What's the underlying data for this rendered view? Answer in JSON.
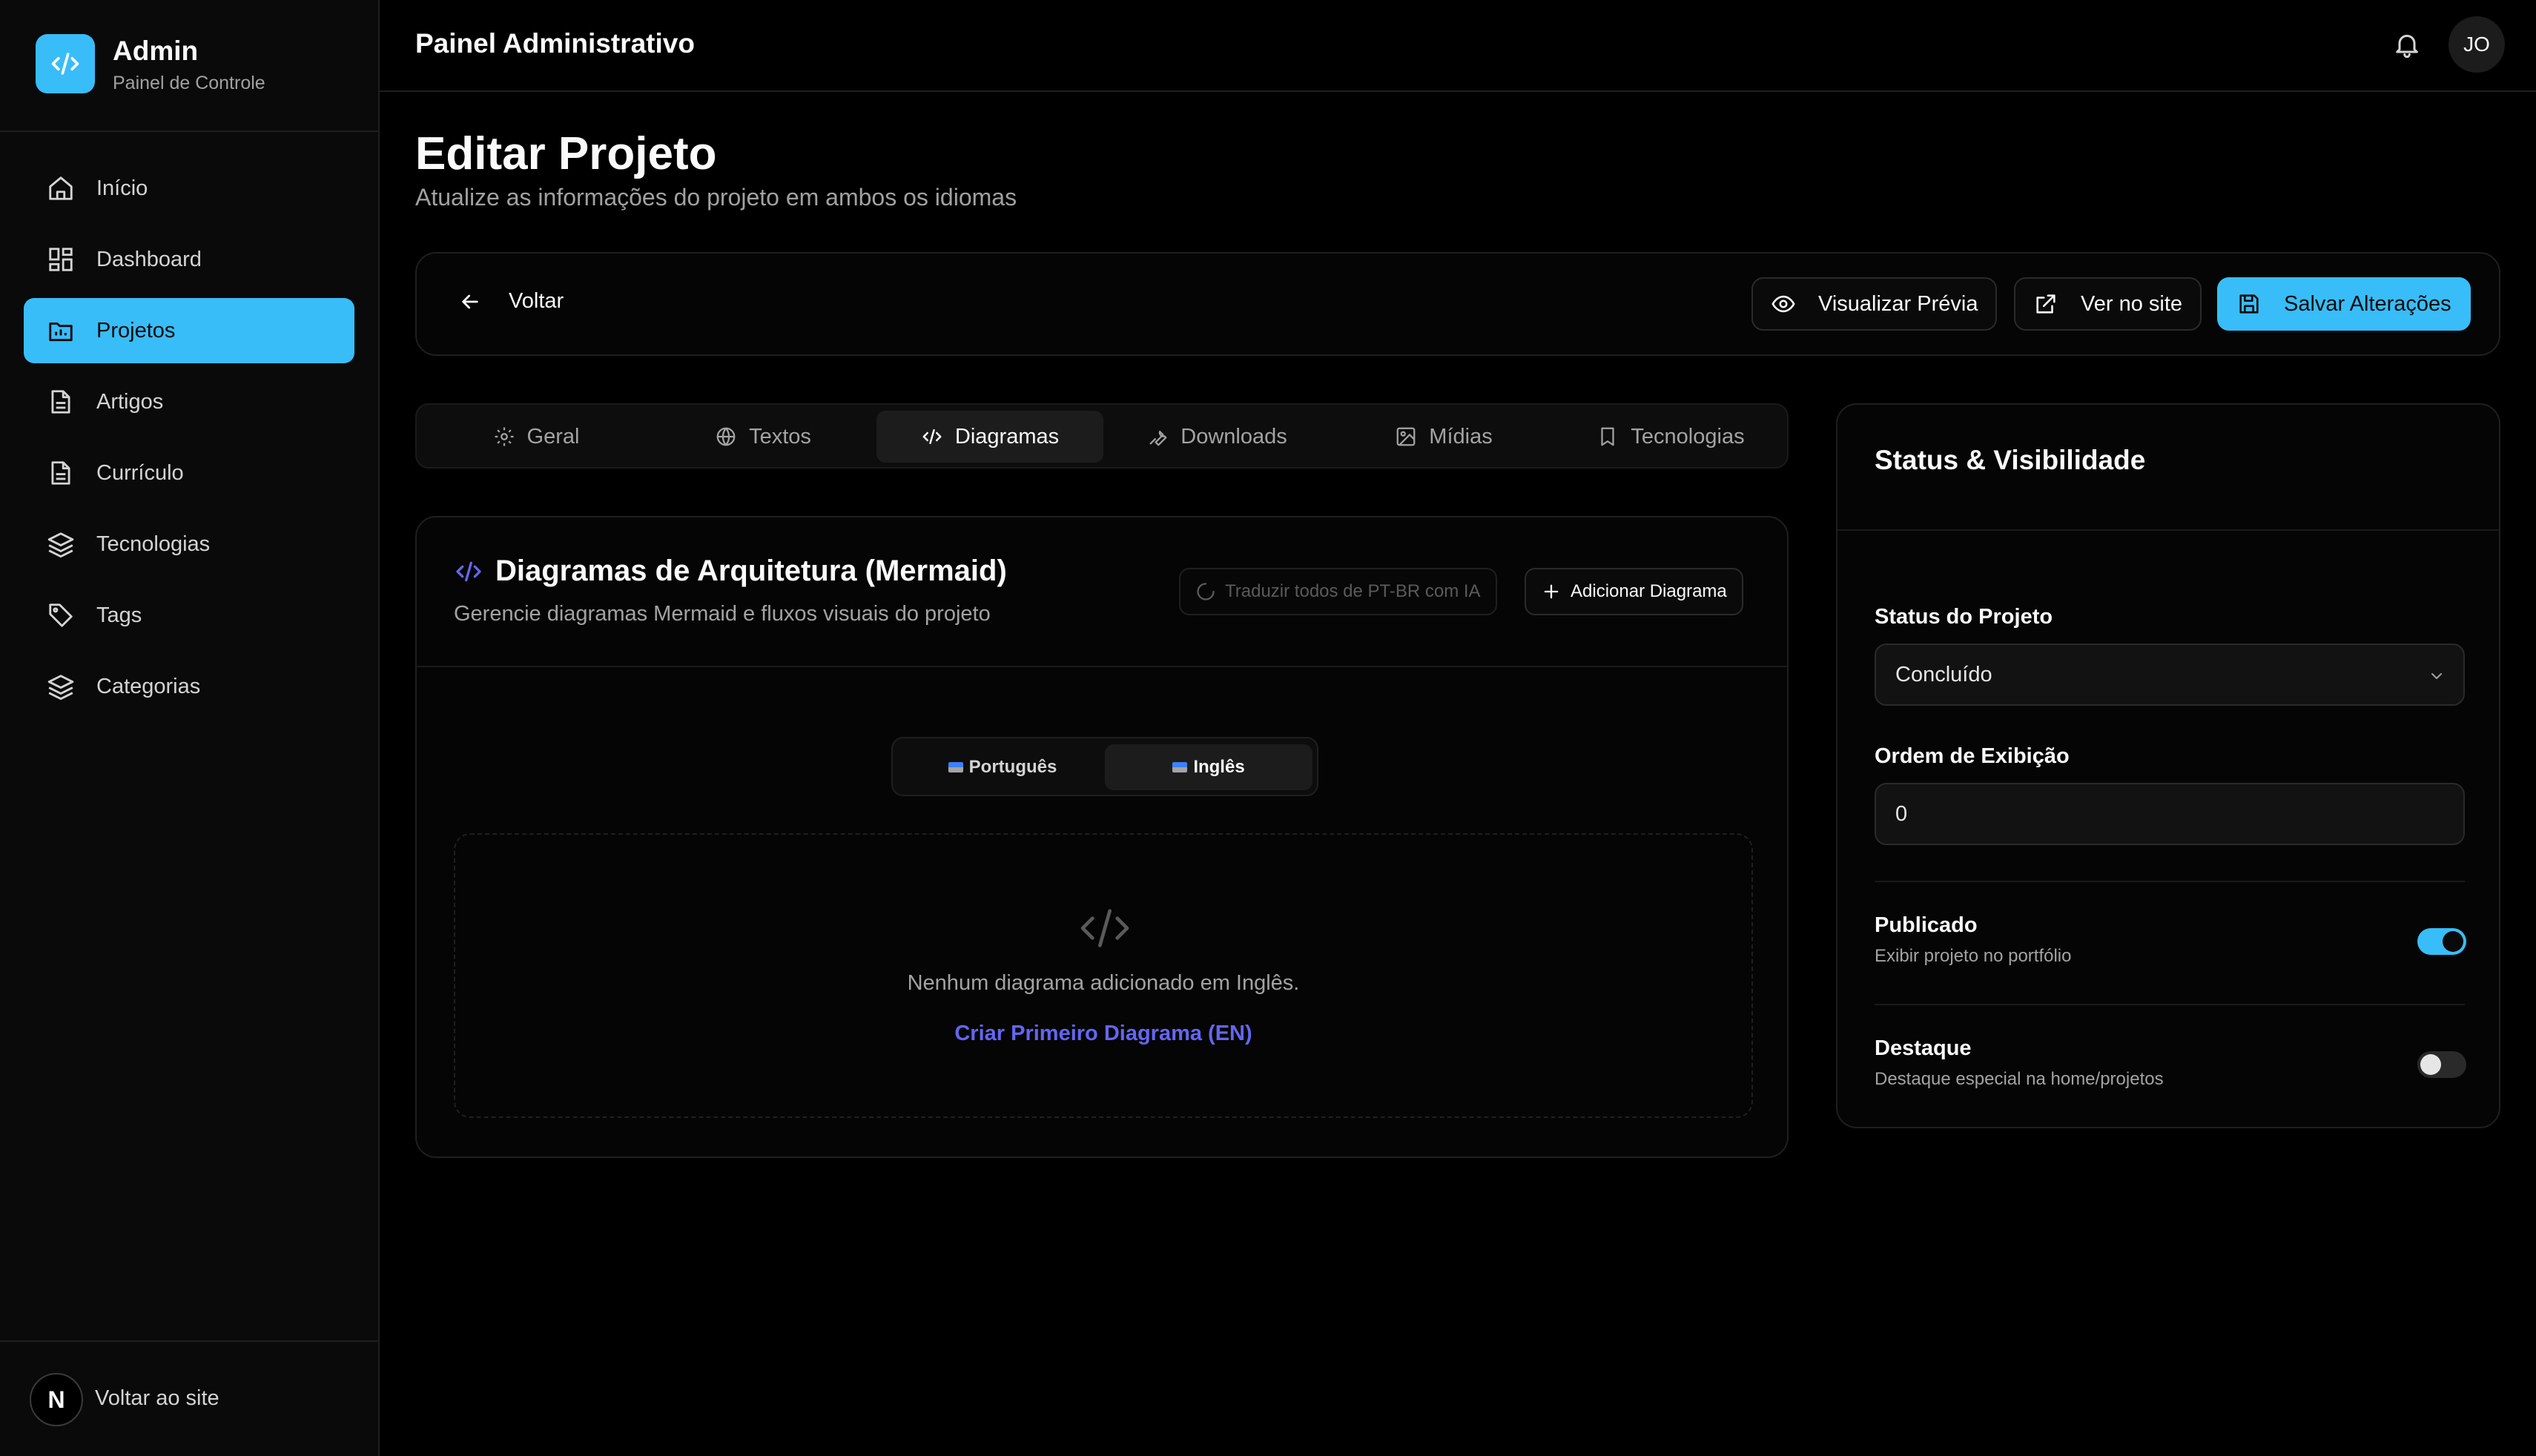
{
  "brand": {
    "title": "Admin",
    "subtitle": "Painel de Controle"
  },
  "sidebar": {
    "items": [
      {
        "label": "Início",
        "icon": "home-icon"
      },
      {
        "label": "Dashboard",
        "icon": "dashboard-icon"
      },
      {
        "label": "Projetos",
        "icon": "folder-icon",
        "active": true
      },
      {
        "label": "Artigos",
        "icon": "file-icon"
      },
      {
        "label": "Currículo",
        "icon": "file-icon"
      },
      {
        "label": "Tecnologias",
        "icon": "layers-icon"
      },
      {
        "label": "Tags",
        "icon": "tag-icon"
      },
      {
        "label": "Categorias",
        "icon": "layers-icon"
      }
    ],
    "footer": {
      "avatar_letter": "N",
      "label": "Voltar ao site"
    }
  },
  "header": {
    "title": "Painel Administrativo",
    "user_initials": "JO"
  },
  "page": {
    "title": "Editar Projeto",
    "subtitle": "Atualize as informações do projeto em ambos os idiomas"
  },
  "actions": {
    "back": "Voltar",
    "preview": "Visualizar Prévia",
    "view_site": "Ver no site",
    "save": "Salvar Alterações"
  },
  "tabs": [
    {
      "label": "Geral",
      "icon": "gear-icon"
    },
    {
      "label": "Textos",
      "icon": "globe-icon"
    },
    {
      "label": "Diagramas",
      "icon": "code-icon",
      "active": true
    },
    {
      "label": "Downloads",
      "icon": "wrench-icon"
    },
    {
      "label": "Mídias",
      "icon": "image-icon"
    },
    {
      "label": "Tecnologias",
      "icon": "bookmark-icon"
    }
  ],
  "diagrams": {
    "title": "Diagramas de Arquitetura (Mermaid)",
    "subtitle": "Gerencie diagramas Mermaid e fluxos visuais do projeto",
    "translate_button": "Traduzir todos de PT-BR com IA",
    "add_button": "Adicionar Diagrama",
    "languages": [
      "Português",
      "Inglês"
    ],
    "active_language": "Inglês",
    "empty_text": "Nenhum diagrama adicionado em Inglês.",
    "empty_link": "Criar Primeiro Diagrama (EN)"
  },
  "status": {
    "title": "Status & Visibilidade",
    "project_status_label": "Status do Projeto",
    "project_status_value": "Concluído",
    "order_label": "Ordem de Exibição",
    "order_value": "0",
    "published_title": "Publicado",
    "published_sub": "Exibir projeto no portfólio",
    "published_on": true,
    "featured_title": "Destaque",
    "featured_sub": "Destaque especial na home/projetos",
    "featured_on": false
  },
  "colors": {
    "accent": "#38bdf8",
    "link": "#6366f1",
    "background": "#000000"
  }
}
